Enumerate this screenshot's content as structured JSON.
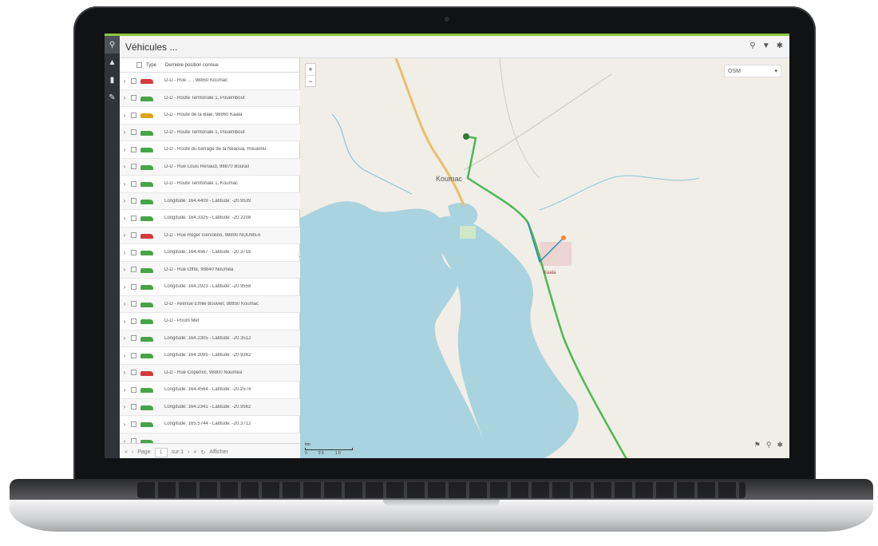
{
  "app": {
    "title": "Véhicules ...",
    "accent": "#8cc63f",
    "rail": [
      {
        "icon": "map-marker-icon",
        "glyph": "⚲"
      },
      {
        "icon": "warning-icon",
        "glyph": "▲"
      },
      {
        "icon": "document-icon",
        "glyph": "▮"
      },
      {
        "icon": "leaf-icon",
        "glyph": "✎"
      }
    ],
    "top_icons": [
      {
        "icon": "search-icon",
        "glyph": "⚲"
      },
      {
        "icon": "filter-icon",
        "glyph": "▼"
      },
      {
        "icon": "gear-icon",
        "glyph": "✱"
      }
    ]
  },
  "list": {
    "header": {
      "type": "Type",
      "position": "Dernière position connue"
    },
    "rows": [
      {
        "color": "#d63a3a",
        "address": "D-D - Rue ... , 98850 Koumac"
      },
      {
        "color": "#47a447",
        "address": "D-D - Route Territoriale 1, Pouembout"
      },
      {
        "color": "#e0a21a",
        "address": "D-D - Route de la Baie, 98860 Kaala"
      },
      {
        "color": "#47a447",
        "address": "D-D - Route Territoriale 1, Pouembout"
      },
      {
        "color": "#47a447",
        "address": "D-D - Route du barrage de la Néaoua, Houaïlou"
      },
      {
        "color": "#47a447",
        "address": "D-D - Rue Louis Renaud, 98870 Bourail"
      },
      {
        "color": "#47a447",
        "address": "D-D - Route Territoriale 1, Koumac"
      },
      {
        "color": "#47a447",
        "address": "Longitude: 164.4409 - Latitude: -20.9539"
      },
      {
        "color": "#47a447",
        "address": "Longitude: 164.3325 - Latitude: -20.2208"
      },
      {
        "color": "#d63a3a",
        "address": "D-D - Rue Roger Gervolino, 98800 NOUMÉA"
      },
      {
        "color": "#47a447",
        "address": "Longitude: 164.4567 - Latitude: -20.3716"
      },
      {
        "color": "#47a447",
        "address": "D-D - Rue Offre, 98840 Nouméa"
      },
      {
        "color": "#47a447",
        "address": "Longitude: 164.2923 - Latitude: -20.9558"
      },
      {
        "color": "#47a447",
        "address": "D-D - Avenue Emile Bouvier, 98850 Koumac"
      },
      {
        "color": "#47a447",
        "address": "D-D - Poum Mer"
      },
      {
        "color": "#47a447",
        "address": "Longitude: 164.2305 - Latitude: -20.3512"
      },
      {
        "color": "#47a447",
        "address": "Longitude: 164.3095 - Latitude: -20.9362"
      },
      {
        "color": "#d63a3a",
        "address": "D-D - Rue Copernic, 98800 Nouméa"
      },
      {
        "color": "#47a447",
        "address": "Longitude: 164.4564 - Latitude: -20.2574"
      },
      {
        "color": "#47a447",
        "address": "Longitude: 164.2341 - Latitude: -20.9562"
      },
      {
        "color": "#47a447",
        "address": "Longitude: 165.5744 - Latitude: -20.3712"
      },
      {
        "color": "#47a447",
        "address": ""
      }
    ],
    "pager": {
      "page_label": "Page",
      "page_value": "1",
      "of_label": "sur 1",
      "items_label": "Afficher"
    }
  },
  "map": {
    "zoom_in": "+",
    "zoom_out": "−",
    "layer_value": "OSM",
    "labels": {
      "town": "Koumac",
      "district": "Kaala"
    },
    "scale": {
      "unit": "km",
      "ticks": [
        "0",
        "0.5",
        "1.0"
      ]
    },
    "water_color": "#a9d3de",
    "route_color": "#2fae3a",
    "tools": [
      {
        "icon": "flag-icon",
        "glyph": "⚑"
      },
      {
        "icon": "search-icon",
        "glyph": "⚲"
      },
      {
        "icon": "gear-icon",
        "glyph": "✱"
      }
    ]
  }
}
